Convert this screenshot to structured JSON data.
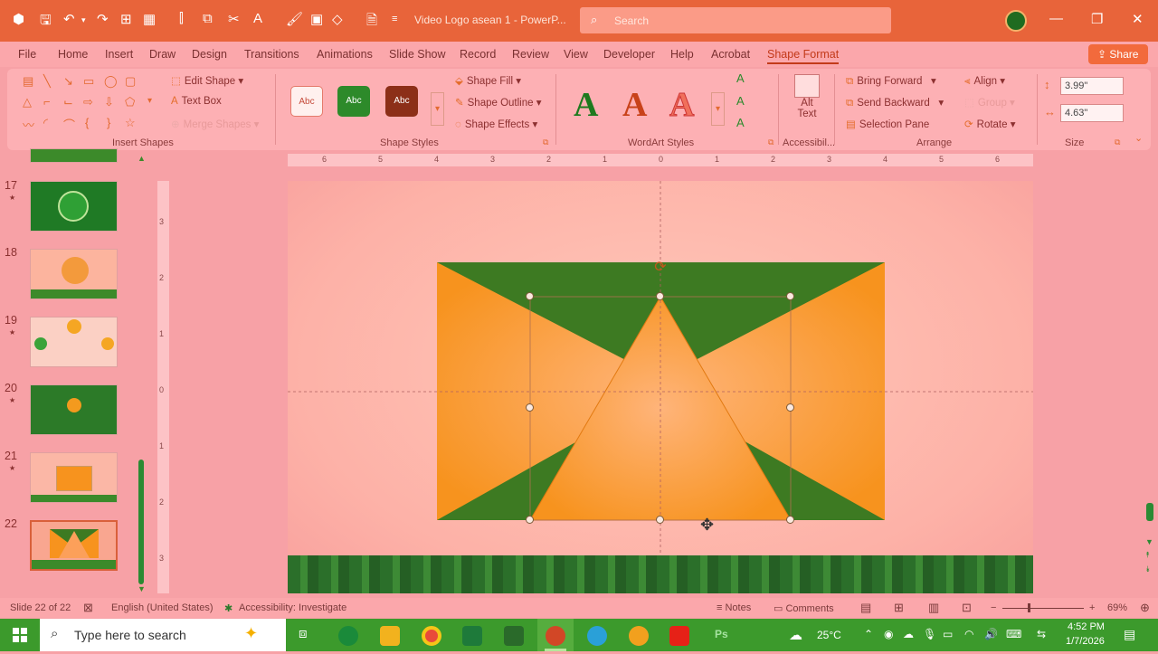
{
  "titlebar": {
    "doc_title": "Video Logo asean 1  -  PowerP...",
    "search_placeholder": "Search",
    "minimize": "—",
    "restore": "❐",
    "close": "✕"
  },
  "menu": {
    "tabs": [
      "File",
      "Home",
      "Insert",
      "Draw",
      "Design",
      "Transitions",
      "Animations",
      "Slide Show",
      "Record",
      "Review",
      "View",
      "Developer",
      "Help",
      "Acrobat",
      "Shape Format"
    ],
    "active_tab": "Shape Format",
    "share": "Share"
  },
  "ribbon": {
    "insert_shapes": {
      "label": "Insert Shapes",
      "edit_shape": "Edit Shape",
      "text_box": "Text Box",
      "merge_shapes": "Merge Shapes"
    },
    "shape_styles": {
      "label": "Shape Styles",
      "style_samples": [
        "Abc",
        "Abc",
        "Abc"
      ],
      "shape_fill": "Shape Fill",
      "shape_outline": "Shape Outline",
      "shape_effects": "Shape Effects"
    },
    "wordart": {
      "label": "WordArt Styles",
      "samples": [
        "A",
        "A",
        "A"
      ]
    },
    "accessibility": {
      "label": "Accessibil...",
      "alt_text_line1": "Alt",
      "alt_text_line2": "Text"
    },
    "arrange": {
      "label": "Arrange",
      "bring_forward": "Bring Forward",
      "send_backward": "Send Backward",
      "selection_pane": "Selection Pane",
      "align": "Align",
      "group": "Group",
      "rotate": "Rotate"
    },
    "size": {
      "label": "Size",
      "height": "3.99\"",
      "width": "4.63\""
    }
  },
  "ruler": {
    "horizontal": [
      "6",
      "5",
      "4",
      "3",
      "2",
      "1",
      "0",
      "1",
      "2",
      "3",
      "4",
      "5",
      "6"
    ],
    "vertical": [
      "3",
      "2",
      "1",
      "0",
      "1",
      "2",
      "3"
    ]
  },
  "thumbnails": [
    {
      "num": "17",
      "star": "★"
    },
    {
      "num": "18",
      "star": ""
    },
    {
      "num": "19",
      "star": "★"
    },
    {
      "num": "20",
      "star": "★"
    },
    {
      "num": "21",
      "star": "★"
    },
    {
      "num": "22",
      "star": ""
    }
  ],
  "status": {
    "slide_count": "Slide 22 of 22",
    "language": "English (United States)",
    "accessibility": "Accessibility: Investigate",
    "notes": "Notes",
    "comments": "Comments",
    "zoom": "69%"
  },
  "taskbar": {
    "search_placeholder": "Type here to search",
    "temperature": "25°C",
    "time": "4:52 PM",
    "date": "1/7/2026",
    "ps_label": "Ps"
  },
  "colors": {
    "accent": "#e8643a",
    "slide_green": "#3d7a22",
    "slide_orange": "#f7931e",
    "taskbar": "#3c9a2c"
  }
}
